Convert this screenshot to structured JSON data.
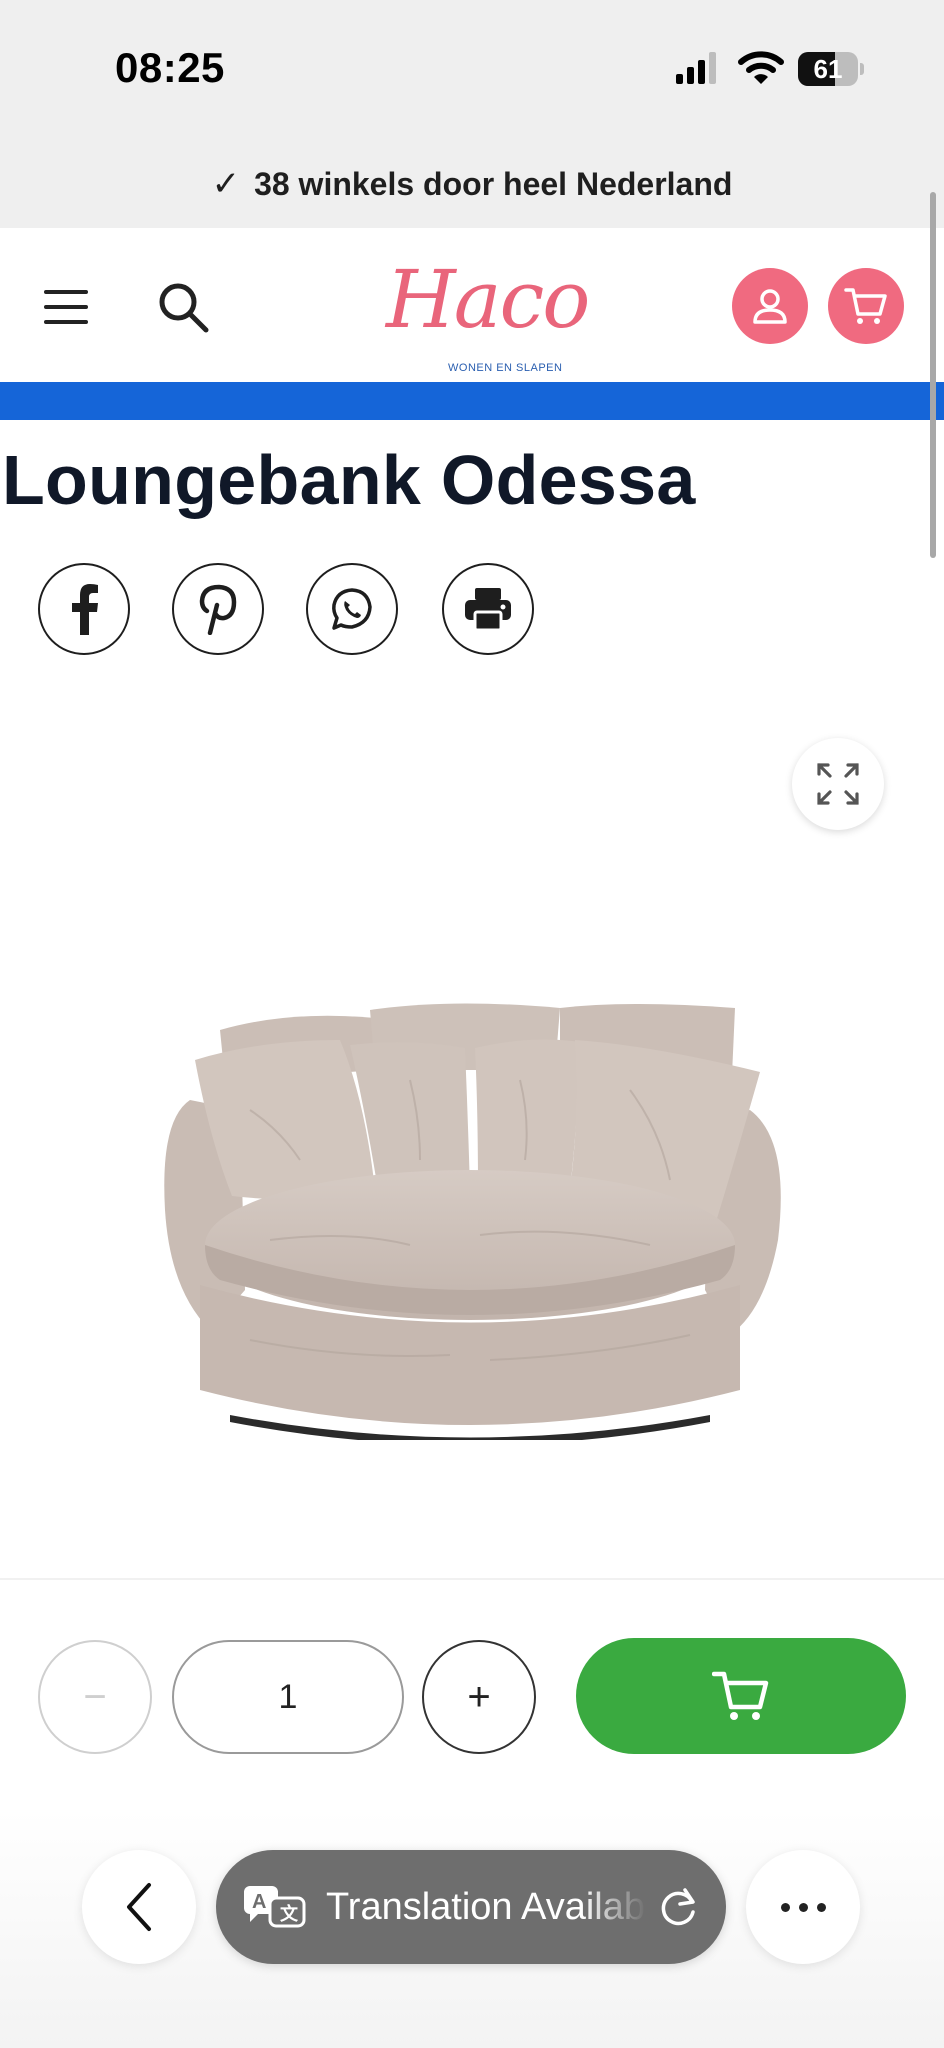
{
  "status_bar": {
    "time": "08:25",
    "battery_level": "61",
    "battery_fraction": 0.61
  },
  "promo_bar": {
    "check_icon": "✓",
    "text": "38 winkels door heel Nederland"
  },
  "header": {
    "menu_icon": "hamburger-icon",
    "search_icon": "search-icon",
    "logo": {
      "wordmark": "Haco",
      "tagline": "WONEN EN SLAPEN"
    },
    "account_icon": "user-icon",
    "cart_icon": "cart-icon",
    "accent_color": "#f06a80",
    "bar_color": "#1565d8"
  },
  "product": {
    "title": "Loungebank Odessa",
    "share_icons": [
      "facebook-icon",
      "pinterest-icon",
      "whatsapp-icon",
      "print-icon"
    ],
    "expand_icon": "expand-icon",
    "image_alt": "sofa-image"
  },
  "purchase": {
    "minus_label": "−",
    "quantity": "1",
    "plus_label": "+",
    "add_to_cart_icon": "cart-icon",
    "button_color": "#3aaa40"
  },
  "browser_bar": {
    "back_icon": "chevron-left-icon",
    "translate_icon": "translate-icon",
    "translation_text": "Translation Available",
    "reload_icon": "reload-icon",
    "more_icon": "more-icon"
  }
}
